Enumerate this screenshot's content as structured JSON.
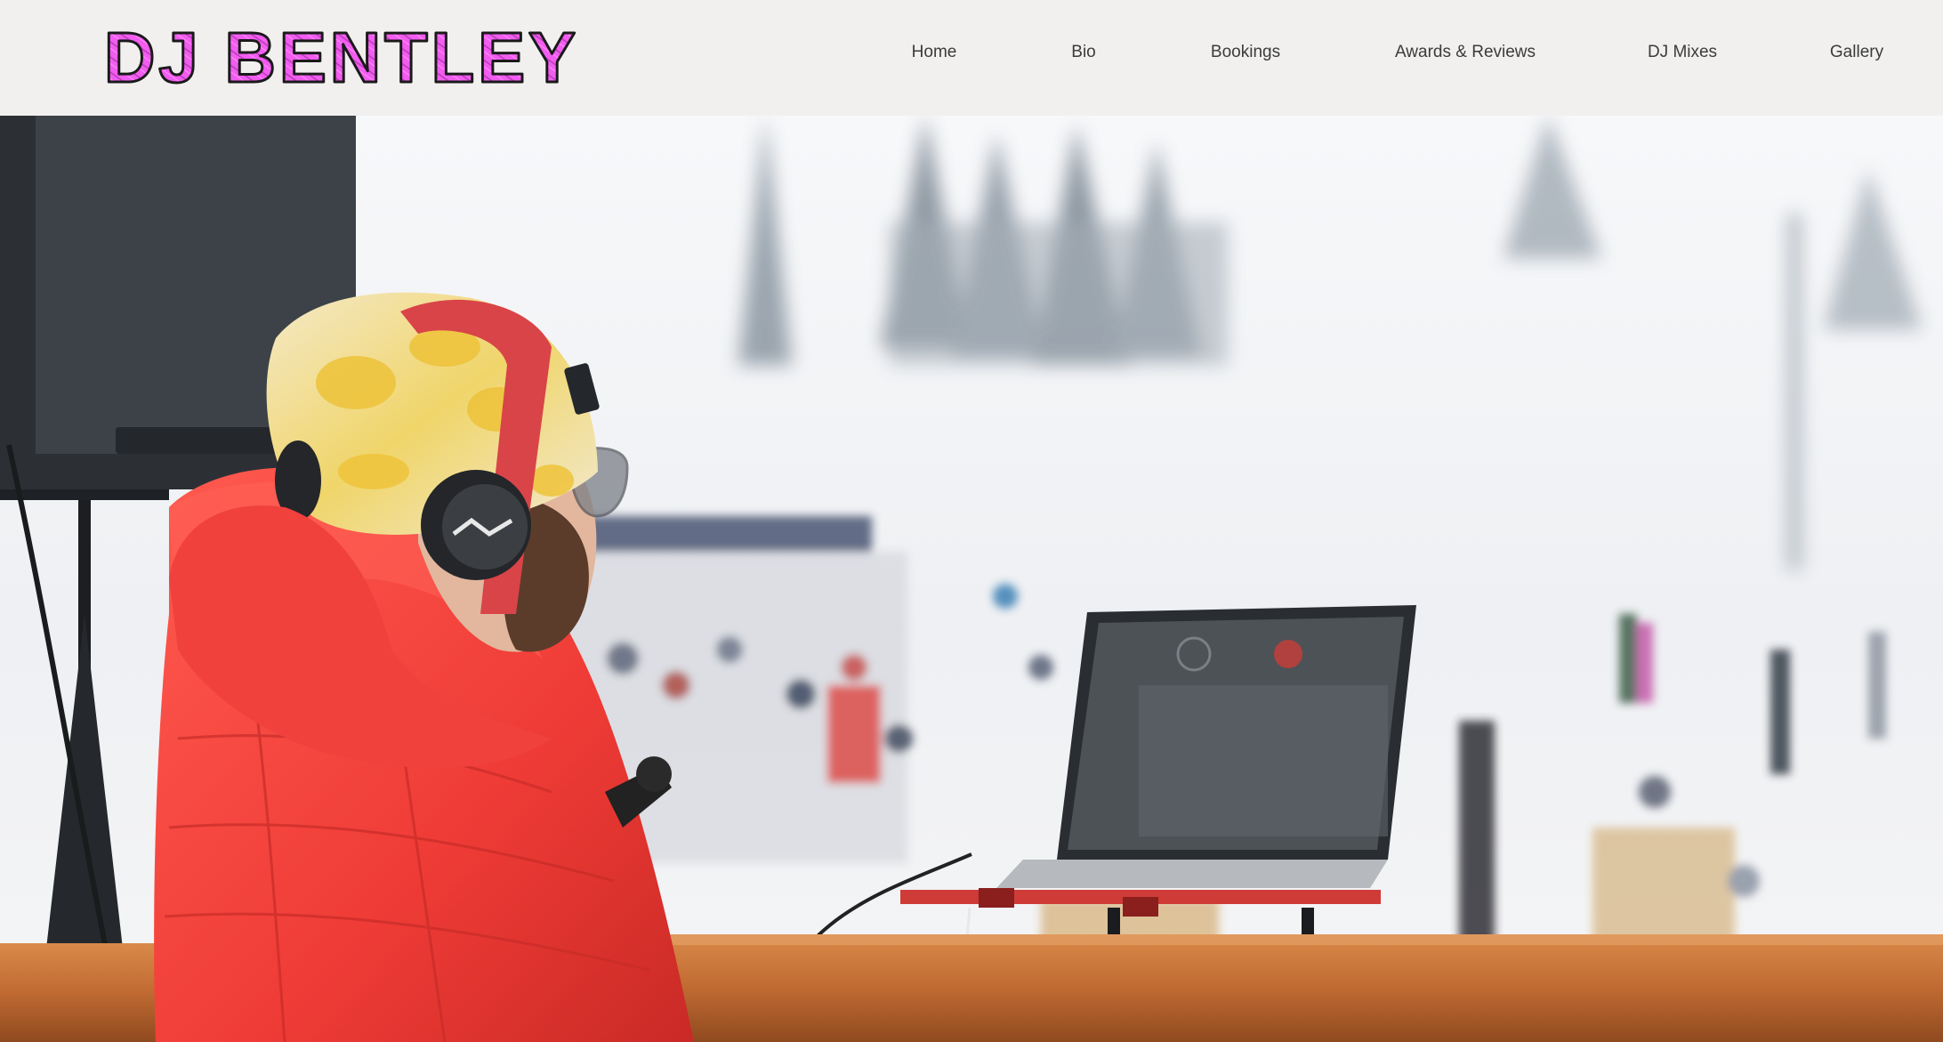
{
  "site": {
    "logo_text": "DJ BENTLEY",
    "logo_colors": {
      "fill": "#f25cf0",
      "outline": "#1a1a1a"
    }
  },
  "nav": {
    "items": [
      {
        "label": "Home"
      },
      {
        "label": "Bio"
      },
      {
        "label": "Bookings"
      },
      {
        "label": "Awards & Reviews"
      },
      {
        "label": "DJ Mixes"
      },
      {
        "label": "Gallery"
      }
    ]
  },
  "hero": {
    "image": "dj-in-red-jacket-with-headphones-and-laptop-at-ski-slope",
    "colors": {
      "jacket": "#ef3b36",
      "snow": "#f4f5f7",
      "rail": "#c06a32"
    }
  }
}
